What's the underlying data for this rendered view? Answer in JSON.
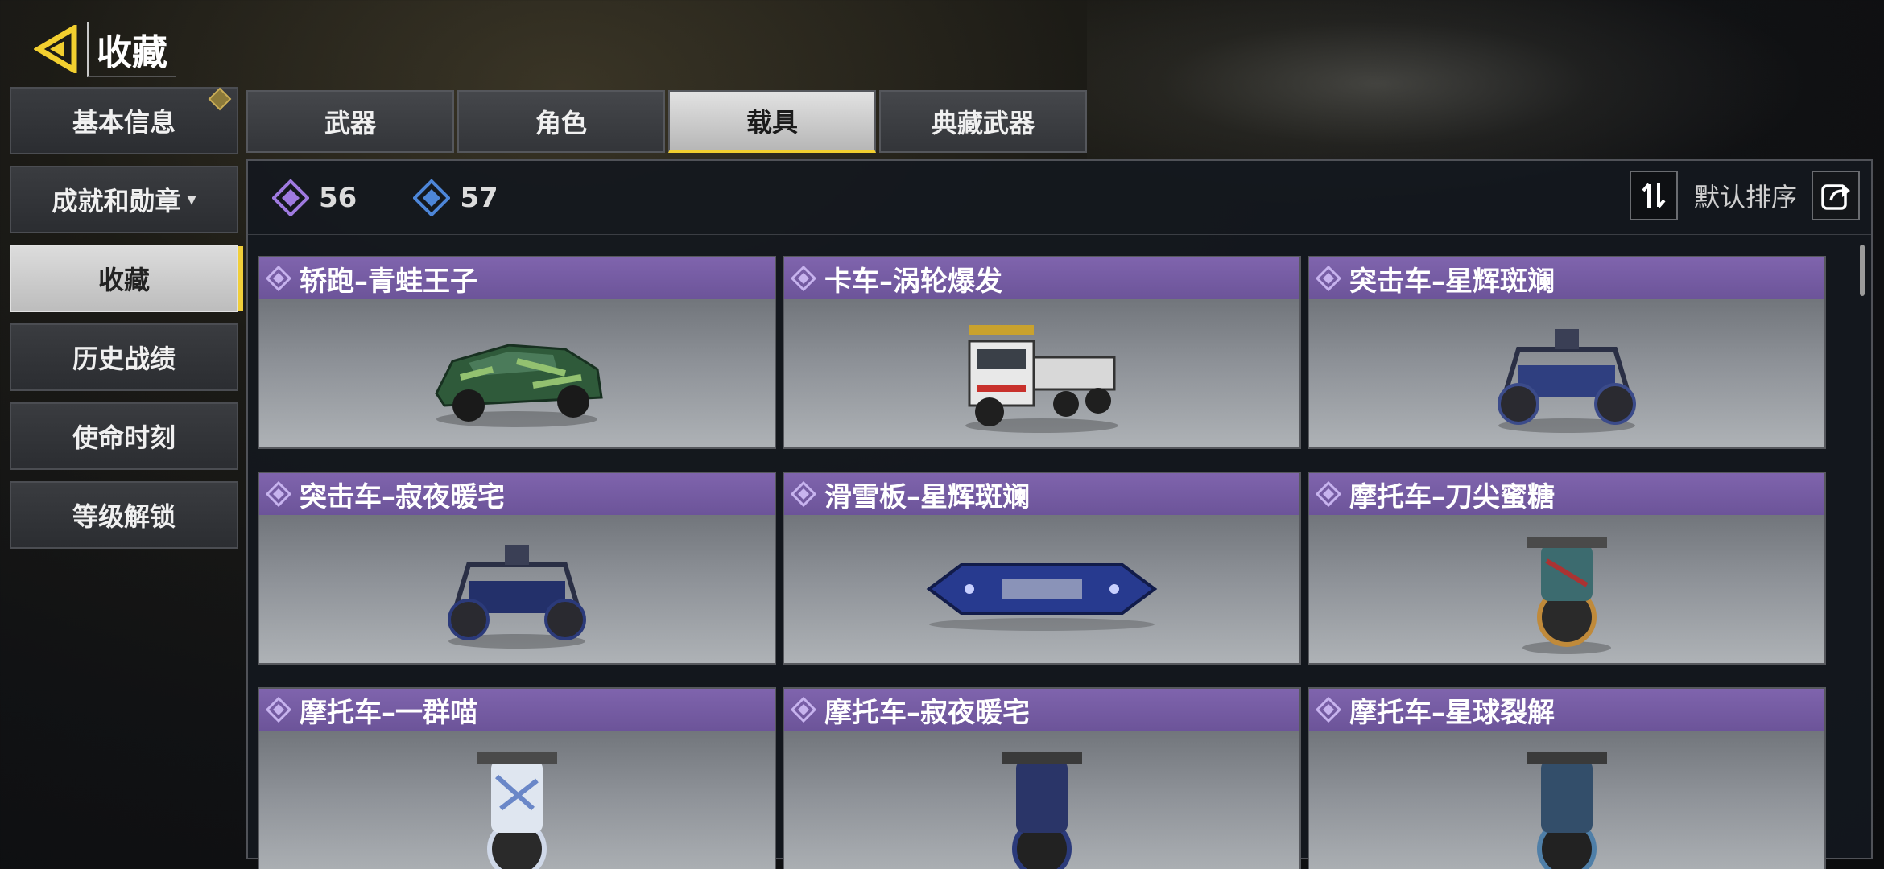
{
  "header": {
    "title": "收藏"
  },
  "sidebar": {
    "items": [
      {
        "label": "基本信息",
        "active": false,
        "dropdown": false,
        "corner_badge": true
      },
      {
        "label": "成就和勋章",
        "active": false,
        "dropdown": true
      },
      {
        "label": "收藏",
        "active": true,
        "dropdown": false
      },
      {
        "label": "历史战绩",
        "active": false,
        "dropdown": false
      },
      {
        "label": "使命时刻",
        "active": false,
        "dropdown": false
      },
      {
        "label": "等级解锁",
        "active": false,
        "dropdown": false
      }
    ]
  },
  "tabs": [
    {
      "label": "武器",
      "active": false
    },
    {
      "label": "角色",
      "active": false
    },
    {
      "label": "载具",
      "active": true
    },
    {
      "label": "典藏武器",
      "active": false
    }
  ],
  "counters": [
    {
      "icon": "purple-diamond-icon",
      "value": "56",
      "color": "#9f7ae0"
    },
    {
      "icon": "blue-diamond-icon",
      "value": "57",
      "color": "#4d86d8"
    }
  ],
  "sort": {
    "label": "默认排序"
  },
  "cards": [
    {
      "title": "轿跑–青蛙王子",
      "vehicle": "car"
    },
    {
      "title": "卡车–涡轮爆发",
      "vehicle": "truck"
    },
    {
      "title": "突击车–星辉斑斓",
      "vehicle": "buggy"
    },
    {
      "title": "突击车–寂夜暖宅",
      "vehicle": "buggy"
    },
    {
      "title": "滑雪板–星辉斑斓",
      "vehicle": "snowboard"
    },
    {
      "title": "摩托车–刀尖蜜糖",
      "vehicle": "motorcycle"
    },
    {
      "title": "摩托车–一群喵",
      "vehicle": "motorcycle"
    },
    {
      "title": "摩托车–寂夜暖宅",
      "vehicle": "motorcycle"
    },
    {
      "title": "摩托车–星球裂解",
      "vehicle": "motorcycle"
    }
  ],
  "colors": {
    "accent_gold": "#f2cf2f",
    "card_header": "#6c5499",
    "panel_bg": "#14181e"
  }
}
